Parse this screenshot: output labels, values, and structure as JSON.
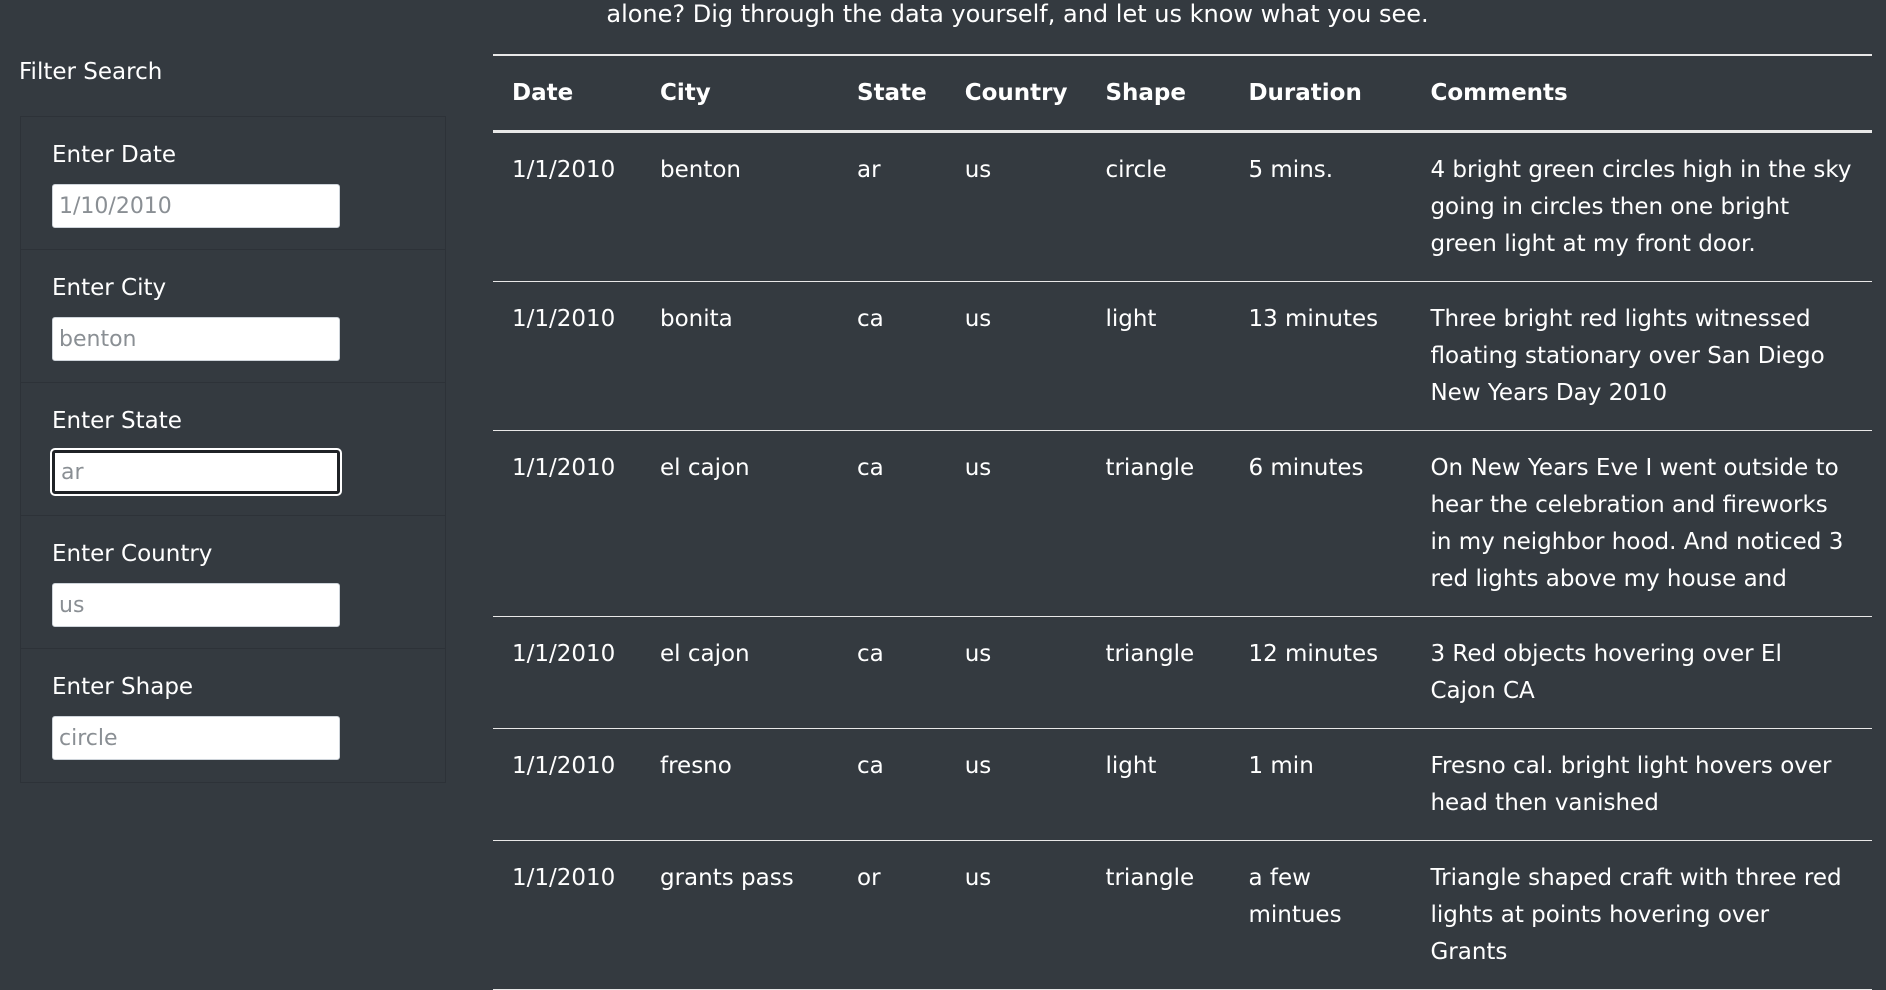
{
  "intro": {
    "text": "alone? Dig through the data yourself, and let us know what you see."
  },
  "filters": {
    "title": "Filter Search",
    "items": [
      {
        "label": "Enter Date",
        "placeholder": "1/10/2010",
        "value": ""
      },
      {
        "label": "Enter City",
        "placeholder": "benton",
        "value": ""
      },
      {
        "label": "Enter State",
        "placeholder": "ar",
        "value": ""
      },
      {
        "label": "Enter Country",
        "placeholder": "us",
        "value": ""
      },
      {
        "label": "Enter Shape",
        "placeholder": "circle",
        "value": ""
      }
    ]
  },
  "table": {
    "headers": [
      "Date",
      "City",
      "State",
      "Country",
      "Shape",
      "Duration",
      "Comments"
    ],
    "rows": [
      [
        "1/1/2010",
        "benton",
        "ar",
        "us",
        "circle",
        "5 mins.",
        "4 bright green circles high in the sky going in circles then one bright green light at my front door."
      ],
      [
        "1/1/2010",
        "bonita",
        "ca",
        "us",
        "light",
        "13 minutes",
        "Three bright red lights witnessed floating stationary over San Diego New Years Day 2010"
      ],
      [
        "1/1/2010",
        "el cajon",
        "ca",
        "us",
        "triangle",
        "6 minutes",
        "On New Years Eve I went outside to hear the celebration and fireworks in my neighbor hood. And noticed 3 red lights above my house and"
      ],
      [
        "1/1/2010",
        "el cajon",
        "ca",
        "us",
        "triangle",
        "12 minutes",
        "3 Red objects hovering over El Cajon CA"
      ],
      [
        "1/1/2010",
        "fresno",
        "ca",
        "us",
        "light",
        "1 min",
        "Fresno cal. bright light hovers over head then vanished"
      ],
      [
        "1/1/2010",
        "grants pass",
        "or",
        "us",
        "triangle",
        "a few mintues",
        "Triangle shaped craft with three red lights at points hovering over Grants"
      ]
    ]
  }
}
